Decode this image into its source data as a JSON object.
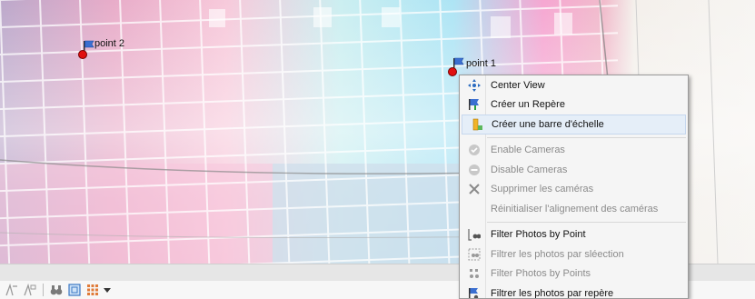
{
  "markers": [
    {
      "id": "point2",
      "label": "point 2"
    },
    {
      "id": "point1",
      "label": "point 1"
    }
  ],
  "context_menu": {
    "items": [
      {
        "label": "Center View",
        "icon": "center-view-icon",
        "enabled": true
      },
      {
        "label": "Créer un Repère",
        "icon": "marker-flag-icon",
        "enabled": true
      },
      {
        "label": "Créer une barre d'échelle",
        "icon": "scale-bar-icon",
        "enabled": true,
        "highlighted": true
      },
      {
        "separator": true
      },
      {
        "label": "Enable Cameras",
        "icon": "enable-cameras-icon",
        "enabled": false
      },
      {
        "label": "Disable Cameras",
        "icon": "disable-cameras-icon",
        "enabled": false
      },
      {
        "label": "Supprimer les caméras",
        "icon": "delete-cross-icon",
        "enabled": false
      },
      {
        "label": "Réinitialiser l'alignement des caméras",
        "icon": "",
        "enabled": false
      },
      {
        "separator": true
      },
      {
        "label": "Filter Photos by Point",
        "icon": "filter-by-point-icon",
        "enabled": true
      },
      {
        "label": "Filtrer les photos par sléection",
        "icon": "filter-by-selection-icon",
        "enabled": false
      },
      {
        "label": "Filter Photos by Points",
        "icon": "filter-by-points-icon",
        "enabled": false
      },
      {
        "label": "Filtrer les photos par repère",
        "icon": "filter-by-marker-icon",
        "enabled": true
      }
    ]
  },
  "toolbar": {
    "icons": [
      "select-camera-icon",
      "select-camera-alt-icon",
      "binoculars-icon",
      "zoom-frame-icon",
      "grid-view-icon",
      "dropdown-arrow-icon"
    ]
  },
  "colors": {
    "marker_dot": "#e01010",
    "menu_highlight": "#e5eef8",
    "flag_blue": "#3b6fd1"
  }
}
